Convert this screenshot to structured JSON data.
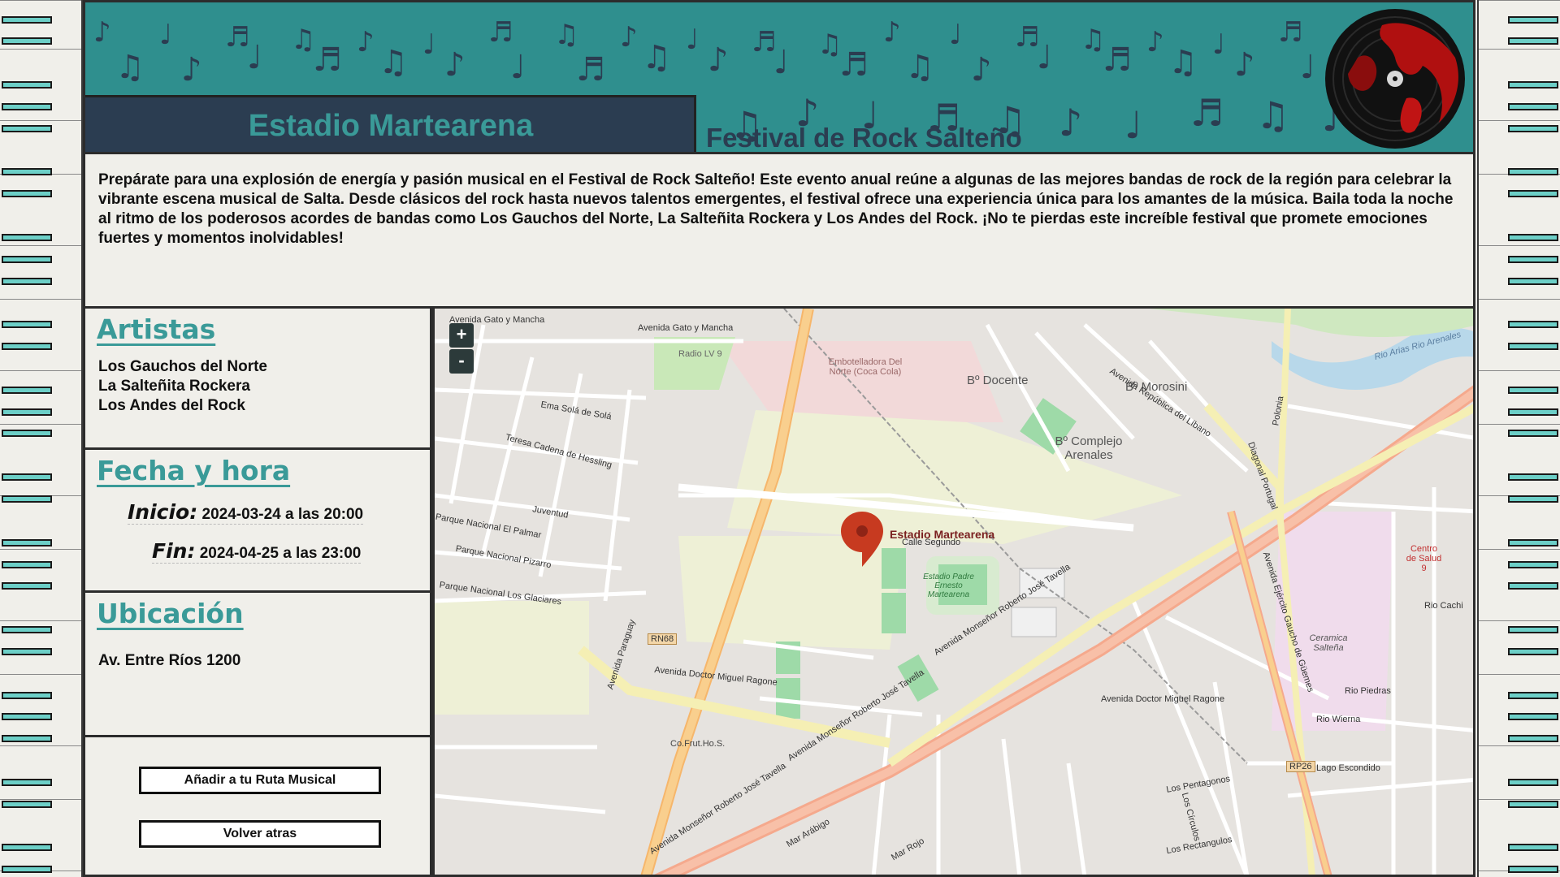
{
  "header": {
    "venue_title": "Estadio Martearena",
    "festival_title": "Festival de Rock Salteño"
  },
  "description": "Prepárate para una explosión de energía y pasión musical en el Festival de Rock Salteño! Este evento anual reúne a algunas de las mejores bandas de rock de la región para celebrar la vibrante escena musical de Salta. Desde clásicos del rock hasta nuevos talentos emergentes, el festival ofrece una experiencia única para los amantes de la música. Baila toda la noche al ritmo de los poderosos acordes de bandas como Los Gauchos del Norte, La Salteñita Rockera y Los Andes del Rock. ¡No te pierdas este increíble festival que promete emociones fuertes y momentos inolvidables!",
  "artists": {
    "heading": "Artistas",
    "items": [
      "Los Gauchos del Norte",
      "La Salteñita Rockera",
      "Los Andes del Rock"
    ]
  },
  "datetime": {
    "heading": "Fecha y hora",
    "start_label": "Inicio:",
    "start_value": "2024-03-24 a las 20:00",
    "end_label": "Fin:",
    "end_value": "2024-04-25 a las 23:00"
  },
  "location": {
    "heading": "Ubicación",
    "address": "Av. Entre Ríos 1200"
  },
  "actions": {
    "add_route": "Añadir a tu Ruta Musical",
    "back": "Volver atras"
  },
  "map": {
    "zoom_in": "+",
    "zoom_out": "-",
    "marker_label": "Estadio Martearena",
    "labels": {
      "avenida_gato": "Avenida Gato y Mancha",
      "avenida_gato_2": "Avenida Gato y Mancha",
      "radio_lv9": "Radio LV 9",
      "embotelladora": "Embotelladora Del Norte (Coca Cola)",
      "b_docente": "Bº Docente",
      "b_morosini": "Bº Morosini",
      "b_complejo": "Bº Complejo Arenales",
      "ema_sola": "Ema Solá de Solá",
      "teresa": "Teresa Cadena de Hessling",
      "juventud": "Juventud",
      "parque_palmar": "Parque Nacional El Palmar",
      "parque_pizarro": "Parque Nacional Pizarro",
      "parque_glaciares": "Parque Nacional Los Glaciares",
      "avenida_paraguay": "Avenida Paraguay",
      "avenida_ragone": "Avenida Doctor Miguel Ragone",
      "avenida_ragone_2": "Avenida Doctor Miguel Ragone",
      "avenida_tavella": "Avenida Monseñor Roberto José Tavella",
      "avenida_tavella_2": "Avenida Monseñor Roberto José Tavella",
      "avenida_tavella_3": "Avenida Monseñor Roberto José Tavella",
      "avenida_ejercito": "Avenida Ejército Gaucho de Güemes",
      "cofrutho": "Co.Frut.Ho.S.",
      "ceramica": "Ceramica Salteña",
      "centro_salud": "Centro de Salud 9",
      "rn68": "RN68",
      "rp26": "RP26",
      "diagonal": "Diagonal Portugal",
      "polonia": "Polonia",
      "rio_arias": "Rio Arias Rio Arenales",
      "lago_escondido": "Lago Escondido",
      "rio_piedras": "Rio Piedras",
      "rio_wierna": "Rio Wierna",
      "rio_cachi": "Rio Cachi",
      "estadio_inner": "Estadio Padre Ernesto Martearena",
      "calle_segundo": "Calle Segundo",
      "los_pentagonos": "Los Pentagonos",
      "los_rectangulos": "Los Rectangulos",
      "los_circulos": "Los Círculos",
      "mar_rojo": "Mar Rojo",
      "mar_arabigo": "Mar Arábigo",
      "republica_libano": "Avenida República del Líbano"
    }
  }
}
